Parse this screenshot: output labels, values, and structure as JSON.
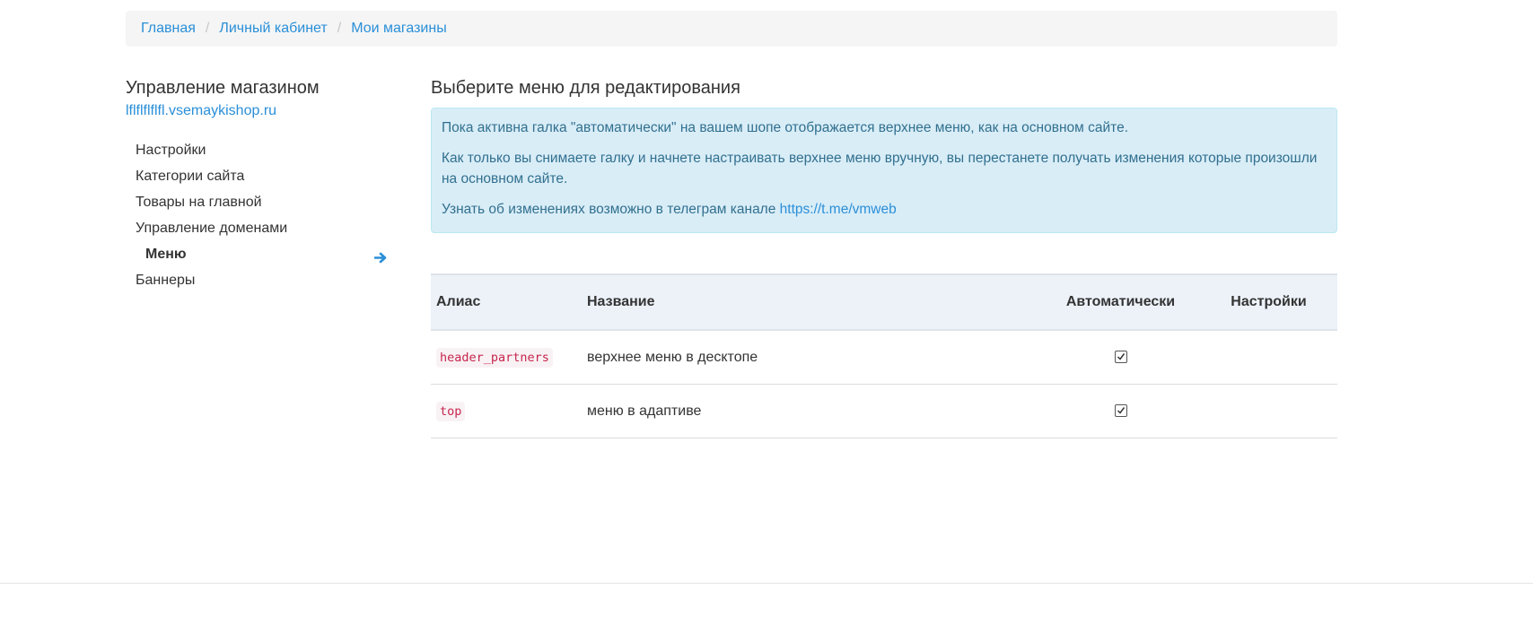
{
  "breadcrumb": {
    "items": [
      "Главная",
      "Личный кабинет",
      "Мои магазины"
    ],
    "separator": "/"
  },
  "sidebar": {
    "title": "Управление магазином",
    "domain": "lflflflflfl.vsemaykishop.ru",
    "items": [
      {
        "label": "Настройки"
      },
      {
        "label": "Категории сайта"
      },
      {
        "label": "Товары на главной"
      },
      {
        "label": "Управление доменами"
      },
      {
        "label": "Меню",
        "active": true
      },
      {
        "label": "Баннеры"
      }
    ],
    "active_icon": "arrow-right-icon"
  },
  "main": {
    "title": "Выберите меню для редактирования",
    "alert": {
      "p1": "Пока активна галка \"автоматически\" на вашем шопе отображается верхнее меню, как на основном сайте.",
      "p2": "Как только вы снимаете галку и начнете настраивать верхнее меню вручную, вы перестанете получать изменения которые произошли на основном сайте.",
      "p3_text": "Узнать об изменениях возможно в телеграм канале ",
      "p3_link": "https://t.me/vmweb"
    },
    "table": {
      "headers": {
        "alias": "Алиас",
        "name": "Название",
        "auto": "Автоматически",
        "settings": "Настройки"
      },
      "rows": [
        {
          "alias": "header_partners",
          "name": "верхнее меню в десктопе",
          "auto": true
        },
        {
          "alias": "top",
          "name": "меню в адаптиве",
          "auto": true
        }
      ]
    }
  },
  "colors": {
    "link": "#2a8fd8",
    "alert_bg": "#d9edf7",
    "alert_text": "#31708f",
    "code_text": "#c7254e",
    "code_bg": "#f9f2f4",
    "table_header_bg": "#ecf2f8"
  }
}
